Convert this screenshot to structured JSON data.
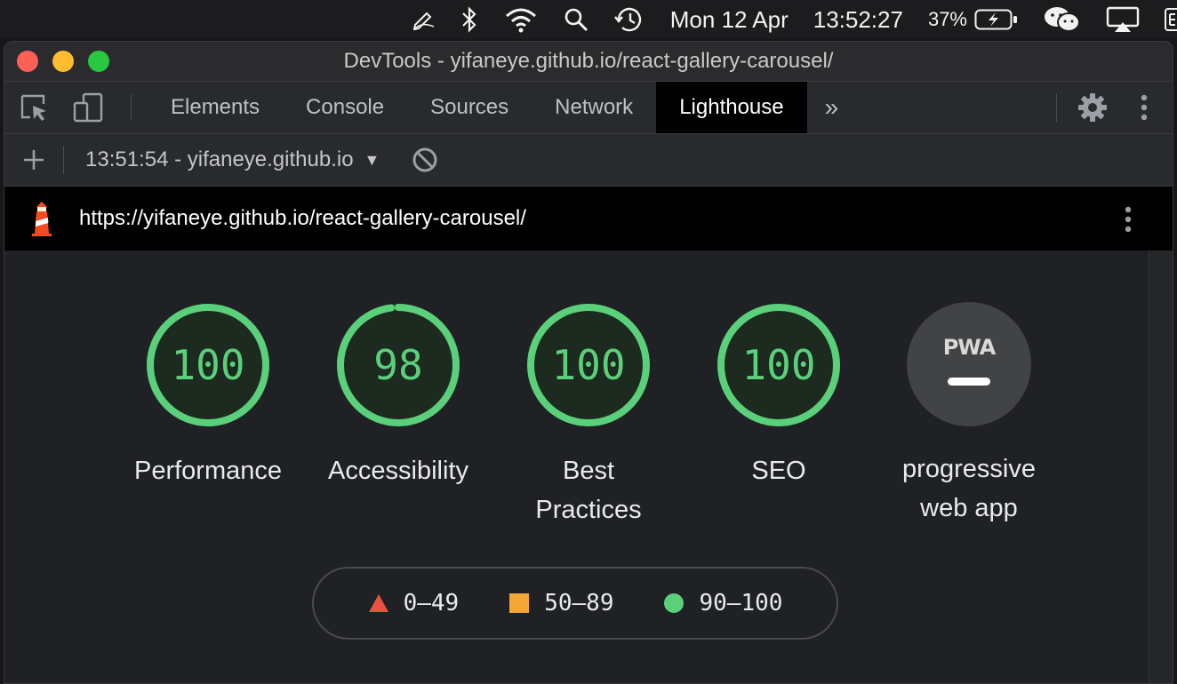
{
  "menubar": {
    "date": "Mon 12 Apr",
    "time": "13:52:27",
    "battery_percent": "37%",
    "icons": [
      "pen-icon",
      "bluetooth-icon",
      "wifi-icon",
      "search-icon",
      "time-machine-icon",
      "battery-charging-icon",
      "wechat-icon",
      "airplay-icon",
      "input-source-icon"
    ]
  },
  "window": {
    "title": "DevTools - yifaneye.github.io/react-gallery-carousel/"
  },
  "tabs": {
    "items": [
      {
        "label": "Elements"
      },
      {
        "label": "Console"
      },
      {
        "label": "Sources"
      },
      {
        "label": "Network"
      },
      {
        "label": "Lighthouse"
      }
    ],
    "more": "»",
    "active": "Lighthouse"
  },
  "report_bar": {
    "selected_report": "13:51:54 - yifaneye.github.io"
  },
  "url_bar": {
    "url": "https://yifaneye.github.io/react-gallery-carousel/"
  },
  "scores": [
    {
      "value": 100,
      "label_lines": [
        "Performance"
      ]
    },
    {
      "value": 98,
      "label_lines": [
        "Accessibility"
      ]
    },
    {
      "value": 100,
      "label_lines": [
        "Best",
        "Practices"
      ]
    },
    {
      "value": 100,
      "label_lines": [
        "SEO"
      ]
    }
  ],
  "pwa": {
    "badge_text": "PWA",
    "label_lines": [
      "progressive",
      "web app"
    ]
  },
  "legend": [
    {
      "shape": "triangle",
      "range": "0–49",
      "color": "#e8523f"
    },
    {
      "shape": "square",
      "range": "50–89",
      "color": "#f4a637"
    },
    {
      "shape": "circle",
      "range": "90–100",
      "color": "#5ad07a"
    }
  ],
  "colors": {
    "pass": "#5ad07a",
    "active_tab": "#000000",
    "background": "#202124"
  }
}
